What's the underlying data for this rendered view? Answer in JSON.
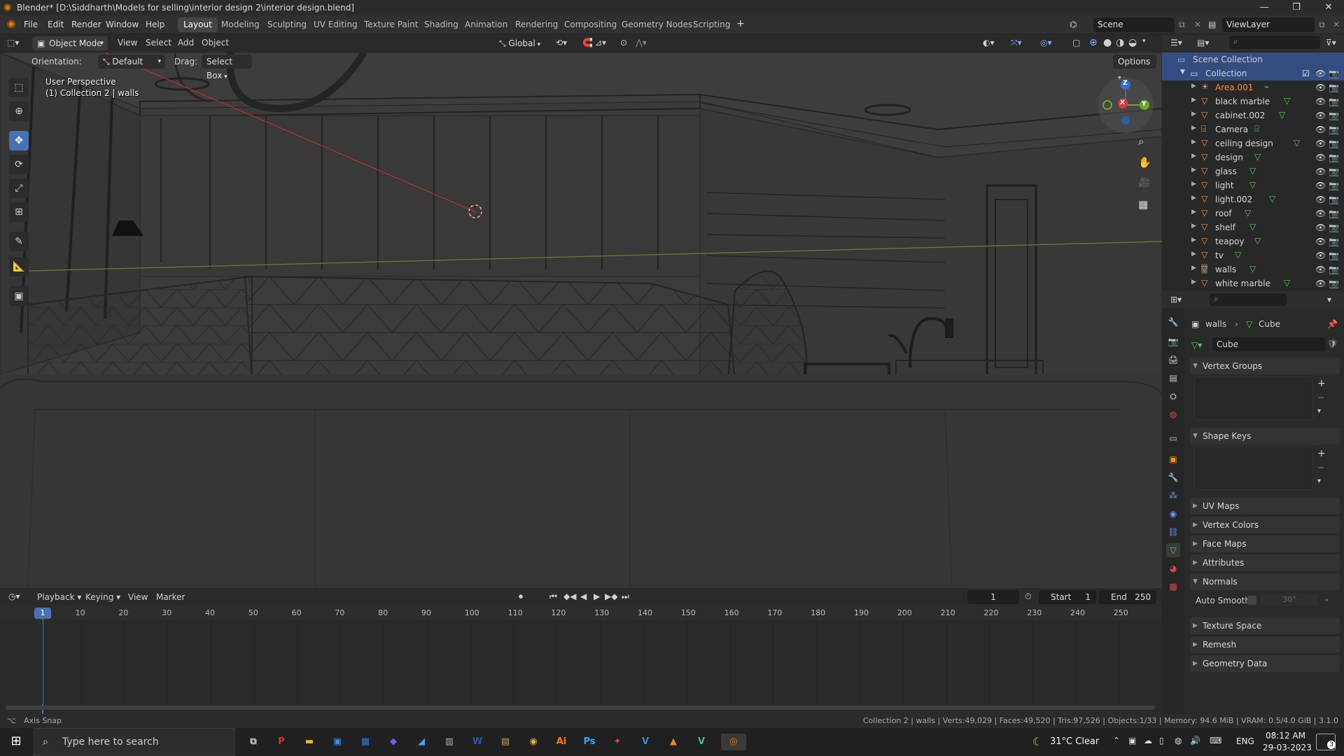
{
  "window": {
    "title": "Blender* [D:\\Siddharth\\Models for selling\\interior design 2\\interior design.blend]"
  },
  "menu": [
    "File",
    "Edit",
    "Render",
    "Window",
    "Help"
  ],
  "workspaces": [
    "Layout",
    "Modeling",
    "Sculpting",
    "UV Editing",
    "Texture Paint",
    "Shading",
    "Animation",
    "Rendering",
    "Compositing",
    "Geometry Nodes",
    "Scripting"
  ],
  "active_workspace": "Layout",
  "scene": "Scene",
  "view_layer": "ViewLayer",
  "viewport_header": {
    "mode": "Object Mode",
    "menus": [
      "View",
      "Select",
      "Add",
      "Object"
    ],
    "transform": "Global"
  },
  "tool_settings": {
    "orientation_label": "Orientation:",
    "orientation_value": "Default",
    "drag_label": "Drag:",
    "drag_value": "Select Box",
    "options": "Options"
  },
  "viewport": {
    "view_name": "User Perspective",
    "collection_info": "(1) Collection 2 | walls",
    "shading": "wireframe"
  },
  "gizmo": {
    "z": "Z",
    "x": "X",
    "y": "Y"
  },
  "outliner": {
    "root": "Scene Collection",
    "collection": "Collection",
    "items": [
      {
        "name": "Area.001",
        "type": "light",
        "highlight": true
      },
      {
        "name": "black marble",
        "type": "mesh"
      },
      {
        "name": "cabinet.002",
        "type": "mesh"
      },
      {
        "name": "Camera",
        "type": "camera"
      },
      {
        "name": "ceiling design",
        "type": "mesh"
      },
      {
        "name": "design",
        "type": "mesh"
      },
      {
        "name": "glass",
        "type": "mesh"
      },
      {
        "name": "light",
        "type": "mesh"
      },
      {
        "name": "light.002",
        "type": "mesh"
      },
      {
        "name": "roof",
        "type": "mesh"
      },
      {
        "name": "shelf",
        "type": "mesh"
      },
      {
        "name": "teapoy",
        "type": "mesh"
      },
      {
        "name": "tv",
        "type": "mesh"
      },
      {
        "name": "walls",
        "type": "mesh",
        "active": true
      },
      {
        "name": "white marble",
        "type": "mesh"
      }
    ]
  },
  "properties": {
    "breadcrumb_object": "walls",
    "breadcrumb_data": "Cube",
    "datablock": "Cube",
    "panels": [
      {
        "label": "Vertex Groups",
        "open": true
      },
      {
        "label": "Shape Keys",
        "open": true
      },
      {
        "label": "UV Maps",
        "open": false
      },
      {
        "label": "Vertex Colors",
        "open": false
      },
      {
        "label": "Face Maps",
        "open": false
      },
      {
        "label": "Attributes",
        "open": false
      },
      {
        "label": "Normals",
        "open": true
      },
      {
        "label": "Texture Space",
        "open": false
      },
      {
        "label": "Remesh",
        "open": false
      },
      {
        "label": "Geometry Data",
        "open": false
      }
    ],
    "auto_smooth_label": "Auto Smooth",
    "auto_smooth_angle": "30°"
  },
  "timeline": {
    "menus": [
      "Playback",
      "Keying",
      "View",
      "Marker"
    ],
    "current_frame": "1",
    "start_label": "Start",
    "start": "1",
    "end_label": "End",
    "end": "250",
    "ticks": [
      "1",
      "10",
      "20",
      "30",
      "40",
      "50",
      "60",
      "70",
      "80",
      "90",
      "100",
      "110",
      "120",
      "130",
      "140",
      "150",
      "160",
      "170",
      "180",
      "190",
      "200",
      "210",
      "220",
      "230",
      "240",
      "250"
    ]
  },
  "status": {
    "left": "Axis Snap",
    "right": "Collection 2 | walls | Verts:49,029 | Faces:49,520 | Tris:97,526 | Objects:1/33 | Memory: 94.6 MiB | VRAM: 0.5/4.0 GiB | 3.1.0"
  },
  "taskbar": {
    "search_placeholder": "Type here to search",
    "weather": "31°C  Clear",
    "language": "ENG",
    "time": "08:12 AM",
    "date": "29-03-2023",
    "notifications": "3",
    "apps": [
      {
        "name": "task-view",
        "glyph": "⧉",
        "color": "#cfcfcf"
      },
      {
        "name": "powerpoint",
        "glyph": "P",
        "color": "#c43e1c"
      },
      {
        "name": "file-explorer",
        "glyph": "▬",
        "color": "#e8b93a"
      },
      {
        "name": "app-3",
        "glyph": "▣",
        "color": "#3a8ee6"
      },
      {
        "name": "store",
        "glyph": "▦",
        "color": "#2f7dd6"
      },
      {
        "name": "app-5",
        "glyph": "◆",
        "color": "#7a5cf0"
      },
      {
        "name": "app-6",
        "glyph": "◢",
        "color": "#4aa3e8"
      },
      {
        "name": "app-7",
        "glyph": "▥",
        "color": "#b0b0b0"
      },
      {
        "name": "word",
        "glyph": "W",
        "color": "#2b579a"
      },
      {
        "name": "app-9",
        "glyph": "▤",
        "color": "#c9a45a"
      },
      {
        "name": "chrome",
        "glyph": "◉",
        "color": "#e0b23a"
      },
      {
        "name": "illustrator",
        "glyph": "Ai",
        "color": "#ff7c00"
      },
      {
        "name": "photoshop",
        "glyph": "Ps",
        "color": "#31a8ff"
      },
      {
        "name": "app-13",
        "glyph": "✦",
        "color": "#e04040"
      },
      {
        "name": "app-14",
        "glyph": "V",
        "color": "#2f8fe0"
      },
      {
        "name": "vlc",
        "glyph": "▲",
        "color": "#f08a00"
      },
      {
        "name": "app-16",
        "glyph": "V",
        "color": "#35c3a0"
      },
      {
        "name": "blender",
        "glyph": "◎",
        "color": "#ea7600"
      }
    ]
  }
}
